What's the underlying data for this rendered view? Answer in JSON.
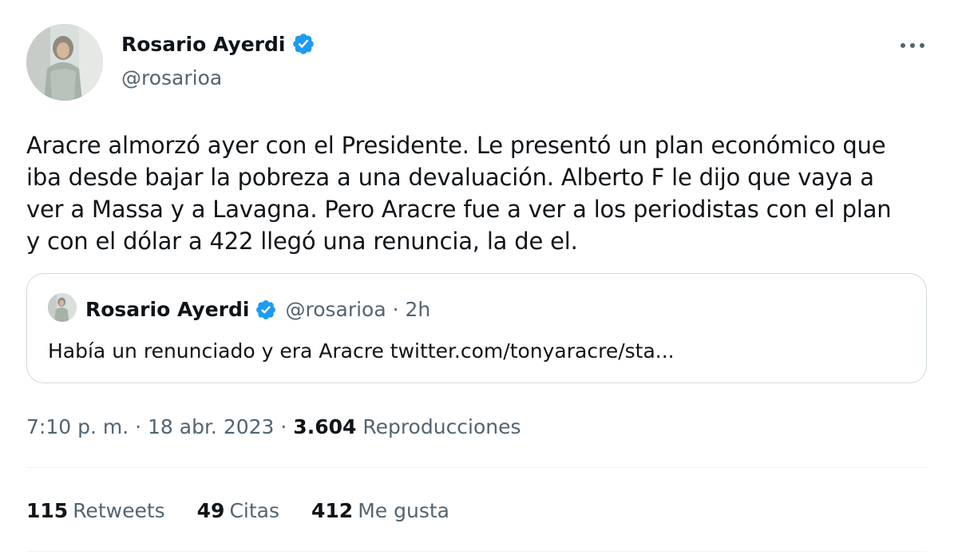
{
  "author": {
    "name": "Rosario Ayerdi",
    "handle": "@rosarioa",
    "verified_icon": "verified-badge-icon",
    "verified_color": "#1d9bf0"
  },
  "more_icon": "more-options-icon",
  "tweet": {
    "lines": [
      "Aracre almorzó ayer con el Presidente. Le presentó un plan económico que",
      "iba desde bajar la pobreza a una devaluación. Alberto F le dijo que vaya a",
      "ver a Massa y a Lavagna. Pero Aracre fue a ver a los periodistas con el plan",
      "y con el dólar a 422 llegó una renuncia, la de el."
    ]
  },
  "quote": {
    "name": "Rosario Ayerdi",
    "meta": "@rosarioa · 2h",
    "text": "Había un renunciado y era Aracre twitter.com/tonyaracre/sta..."
  },
  "meta": {
    "time": "7:10 p. m.",
    "sep1": " · ",
    "date": "18 abr. 2023",
    "sep2": " · ",
    "views": "3.604",
    "views_label": "Reproducciones"
  },
  "stats": {
    "retweets": "115",
    "retweets_label": "Retweets",
    "quotes": "49",
    "quotes_label": "Citas",
    "likes": "412",
    "likes_label": "Me gusta"
  },
  "colors": {
    "text": "#0f1419",
    "secondary": "#536471",
    "border": "#cfd9de",
    "divider": "#eff3f4"
  }
}
